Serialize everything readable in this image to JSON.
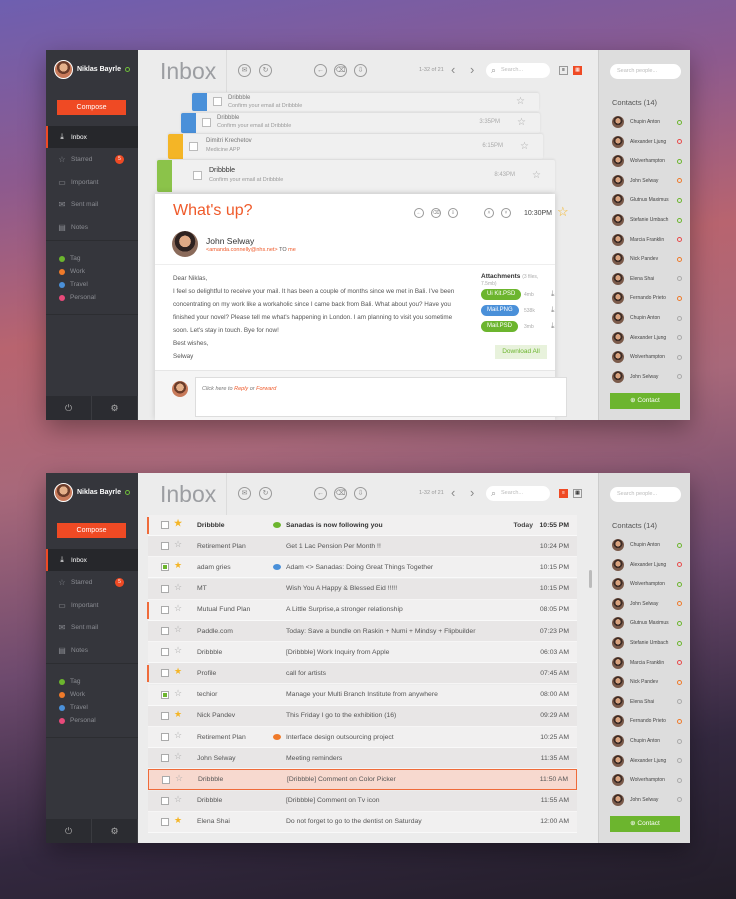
{
  "user": {
    "name": "Niklas Bayrle"
  },
  "compose_label": "Compose",
  "nav": [
    {
      "label": "Inbox",
      "icon": "inbox-icon"
    },
    {
      "label": "Starred",
      "icon": "star-icon",
      "badge": "5"
    },
    {
      "label": "Important",
      "icon": "briefcase-icon"
    },
    {
      "label": "Sent mail",
      "icon": "mail-icon"
    },
    {
      "label": "Notes",
      "icon": "notes-icon"
    }
  ],
  "tags": [
    {
      "label": "Tag",
      "color": "#6cb52e"
    },
    {
      "label": "Work",
      "color": "#ef7a2a"
    },
    {
      "label": "Travel",
      "color": "#4a90d9"
    },
    {
      "label": "Personal",
      "color": "#e84a7a"
    }
  ],
  "header": {
    "title": "Inbox",
    "pager": "1-32 of 21",
    "search_placeholder": "Search...",
    "contact_search_placeholder": "Search people..."
  },
  "contacts_title": "Contacts (14)",
  "contacts": [
    {
      "name": "Chupin Anton",
      "status": "#6cb52e"
    },
    {
      "name": "Alexander Ljung",
      "status": "#e84a4a"
    },
    {
      "name": "Wolverhampton",
      "status": "#6cb52e"
    },
    {
      "name": "John Selway",
      "status": "#ef7a2a"
    },
    {
      "name": "Glutnus Maximus",
      "status": "#6cb52e"
    },
    {
      "name": "Stefanie Umbach",
      "status": "#6cb52e"
    },
    {
      "name": "Marcia Franklin",
      "status": "#e84a4a"
    },
    {
      "name": "Nick Pandev",
      "status": "#ef7a2a"
    },
    {
      "name": "Elena Shai",
      "status": "#aaaaaa"
    },
    {
      "name": "Fernando Prieto",
      "status": "#ef7a2a"
    },
    {
      "name": "Chupin Anton",
      "status": "#aaaaaa"
    },
    {
      "name": "Alexander Ljung",
      "status": "#aaaaaa"
    },
    {
      "name": "Wolverhampton",
      "status": "#aaaaaa"
    },
    {
      "name": "John Selway",
      "status": "#aaaaaa"
    }
  ],
  "add_contact_label": "Contact",
  "stack": [
    {
      "sender": "Dribbble",
      "subject": "Confirm your email at Dribbble",
      "time": "",
      "color": "#4a90d9"
    },
    {
      "sender": "Dribbble",
      "subject": "Confirm your email at Dribbble",
      "time": "3:35PM",
      "color": "#4a90d9"
    },
    {
      "sender": "Dimitri Krechetov",
      "subject": "Medicine APP",
      "time": "6:15PM",
      "color": "#f4b526"
    },
    {
      "sender": "Dribbble",
      "subject": "Confirm your email at Dribbble",
      "time": "8:43PM",
      "color": "#8bc34a"
    }
  ],
  "open_mail": {
    "heading": "What's up?",
    "time": "10:30PM",
    "sender": "John Selway",
    "email": "<amanda.connelly@nhs.net>",
    "to_label": "TO",
    "to_value": "me",
    "greeting": "Dear Niklas,",
    "body": "I feel so delightful to receive your mail. It has been a couple of months since we met in Bali.  I've been concentrating on my work like a workaholic since I came back from Bali. What about you? Have you finished your novel?  Please tell me what's happening in London. I am planning to visit you sometime soon. Let's stay in touch. Bye for now!",
    "signoff": "Best wishes,",
    "signature": "Selway",
    "attachments_title": "Attachments",
    "attachments_meta": "(3 files, 7.5mb)",
    "attachments": [
      {
        "name": "Ui Kit.PSD",
        "size": "4mb",
        "color": "#6cb52e"
      },
      {
        "name": "Mail.PNG",
        "size": "538k",
        "color": "#4a90d9"
      },
      {
        "name": "Mail.PSD",
        "size": "3mb",
        "color": "#6cb52e"
      }
    ],
    "download_all": "Download All",
    "reply_prefix": "Click here to",
    "reply_link": "Reply",
    "reply_or": "or",
    "forward_link": "Forward"
  },
  "mails": [
    {
      "sender": "Dribbble",
      "subject": "Sanadas is now following you",
      "date": "Today",
      "time": "10:55 PM",
      "starred": true,
      "checked": false,
      "dot": "#6cb52e",
      "bold": true,
      "marker": "#ef6b3a"
    },
    {
      "sender": "Retirement Plan",
      "subject": "Get 1 Lac Pension Per Month !!",
      "time": "10:24 PM",
      "starred": false,
      "checked": false
    },
    {
      "sender": "adam gries",
      "subject": "Adam <> Sanadas: Doing Great Things Together",
      "time": "10:15 PM",
      "starred": true,
      "checked": true,
      "dot": "#4a90d9"
    },
    {
      "sender": "MT",
      "subject": "Wish You A Happy & Blessed Eid !!!!!",
      "time": "10:15 PM",
      "starred": false,
      "checked": false
    },
    {
      "sender": "Mutual Fund Plan",
      "subject": "A Little Surprise,a stronger relationship",
      "time": "08:05 PM",
      "starred": false,
      "checked": false,
      "marker": "#ef6b3a"
    },
    {
      "sender": "Paddle.com",
      "subject": "Today: Save a bundle on Raskin + Numi + Mindsy + Flipbuilder",
      "time": "07:23 PM",
      "starred": false,
      "checked": false
    },
    {
      "sender": "Dribbble",
      "subject": "[Dribbble] Work Inquiry from Apple",
      "time": "06:03 AM",
      "starred": false,
      "checked": false
    },
    {
      "sender": "Profile",
      "subject": "call for artists",
      "time": "07:45 AM",
      "starred": true,
      "checked": false,
      "marker": "#ef6b3a"
    },
    {
      "sender": "techior",
      "subject": "Manage your Multi Branch Institute from anywhere",
      "time": "08:00 AM",
      "starred": false,
      "checked": true
    },
    {
      "sender": "Nick Pandev",
      "subject": "This Friday I go to the exhibition   (16)",
      "time": "09:29 AM",
      "starred": true,
      "checked": false
    },
    {
      "sender": "Retirement Plan",
      "subject": "Interface design outsourcing project",
      "time": "10:25 AM",
      "starred": false,
      "checked": false,
      "dot": "#ef7a2a"
    },
    {
      "sender": "John Selway",
      "subject": "Meeting reminders",
      "time": "11:35 AM",
      "starred": false,
      "checked": false
    },
    {
      "sender": "Dribbble",
      "subject": "[Dribbble] Comment on Color Picker",
      "time": "11:50 AM",
      "starred": false,
      "checked": false,
      "selected": true
    },
    {
      "sender": "Dribbble",
      "subject": "[Dribbble] Comment on Tv icon",
      "time": "11:55 AM",
      "starred": false,
      "checked": false
    },
    {
      "sender": "Elena Shai",
      "subject": "Do not forget to go to the dentist on Saturday",
      "time": "12:00 AM",
      "starred": true,
      "checked": false
    }
  ]
}
